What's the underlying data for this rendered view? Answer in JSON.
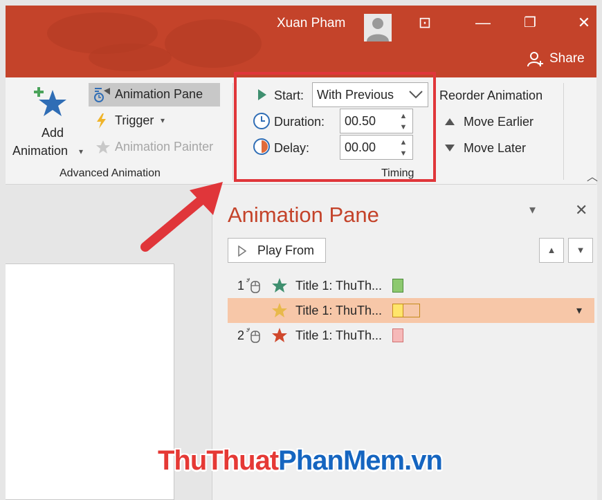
{
  "window": {
    "user_name": "Xuan Pham",
    "share_label": "Share",
    "restore_glyph": "⊡",
    "minimize_glyph": "—",
    "maximize_glyph": "❐",
    "close_glyph": "✕",
    "accent_color": "#c4432a"
  },
  "ribbon": {
    "add_animation": {
      "line1": "Add",
      "line2": "Animation",
      "arrow": "▾"
    },
    "animation_pane_label": "Animation Pane",
    "trigger_label": "Trigger",
    "trigger_arrow": "▾",
    "animation_painter_label": "Animation Painter",
    "advanced_group_label": "Advanced Animation",
    "timing": {
      "start_label": "Start:",
      "start_value": "With Previous",
      "duration_label": "Duration:",
      "duration_value": "00.50",
      "delay_label": "Delay:",
      "delay_value": "00.00",
      "group_label": "Timing"
    },
    "reorder": {
      "title": "Reorder Animation",
      "move_earlier": "Move Earlier",
      "move_later": "Move Later"
    },
    "collapse_glyph": "︿"
  },
  "pane": {
    "title": "Animation Pane",
    "title_color": "#c4432a",
    "menu_glyph": "▾",
    "close_glyph": "✕",
    "play_from_label": "Play From",
    "up_glyph": "▲",
    "down_glyph": "▼",
    "items": [
      {
        "number": "1",
        "label": "Title 1: ThuTh...",
        "star_color": "#3f8f6f",
        "bar_color": "#8dc96f",
        "selected": false
      },
      {
        "number": "",
        "label": "Title 1: ThuTh...",
        "star_color": "#e8b94b",
        "bar_color": "#ffe56b",
        "selected": true
      },
      {
        "number": "2",
        "label": "Title 1: ThuTh...",
        "star_color": "#d0482c",
        "bar_color": "#f6b9b9",
        "selected": false
      }
    ],
    "selected_row_color": "#f7c7a8",
    "row_dropdown_glyph": "▾"
  },
  "watermark": {
    "part1": "ThuThuat",
    "part2": "PhanMem",
    "part3": ".vn"
  }
}
